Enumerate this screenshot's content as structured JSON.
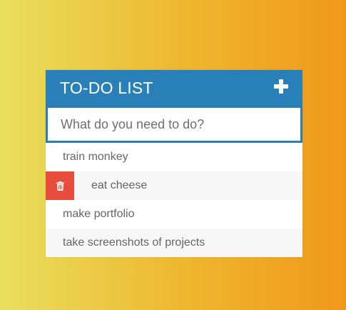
{
  "header": {
    "title": "TO-DO LIST",
    "add_icon": "plus-icon"
  },
  "input": {
    "placeholder": "What do you need to do?",
    "value": ""
  },
  "todos": [
    {
      "label": "train monkey"
    },
    {
      "label": "eat cheese",
      "delete_icon": "trash-icon"
    },
    {
      "label": "make portfolio"
    },
    {
      "label": "take screenshots of projects"
    }
  ],
  "colors": {
    "header": "#2980b9",
    "delete": "#e74c3c",
    "gradient_start": "#e9df5c",
    "gradient_end": "#f0981a"
  }
}
